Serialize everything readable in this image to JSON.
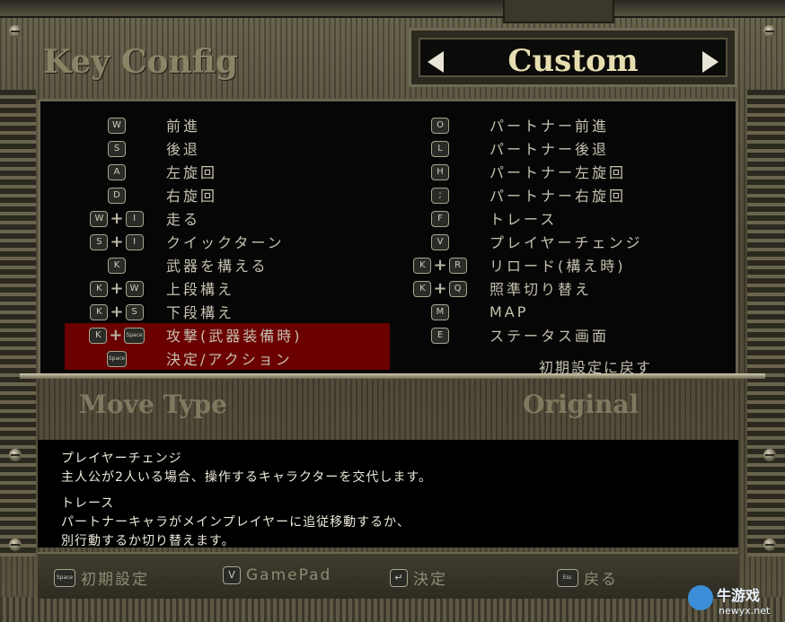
{
  "header": {
    "title": "Key Config",
    "preset": "Custom"
  },
  "bindings_left": [
    {
      "keys": [
        "W"
      ],
      "label": "前進"
    },
    {
      "keys": [
        "S"
      ],
      "label": "後退"
    },
    {
      "keys": [
        "A"
      ],
      "label": "左旋回"
    },
    {
      "keys": [
        "D"
      ],
      "label": "右旋回"
    },
    {
      "keys": [
        "W",
        "+",
        "I"
      ],
      "label": "走る"
    },
    {
      "keys": [
        "S",
        "+",
        "I"
      ],
      "label": "クイックターン"
    },
    {
      "keys": [
        "K"
      ],
      "label": "武器を構える"
    },
    {
      "keys": [
        "K",
        "+",
        "W"
      ],
      "label": "上段構え"
    },
    {
      "keys": [
        "K",
        "+",
        "S"
      ],
      "label": "下段構え"
    },
    {
      "keys": [
        "K",
        "+",
        "Space"
      ],
      "label": "攻撃(武器装備時)"
    },
    {
      "keys": [
        "Space"
      ],
      "label": "決定/アクション"
    }
  ],
  "bindings_right": [
    {
      "keys": [
        "O"
      ],
      "label": "パートナー前進"
    },
    {
      "keys": [
        "L"
      ],
      "label": "パートナー後退"
    },
    {
      "keys": [
        "H"
      ],
      "label": "パートナー左旋回"
    },
    {
      "keys": [
        ";"
      ],
      "label": "パートナー右旋回"
    },
    {
      "keys": [
        "F"
      ],
      "label": "トレース"
    },
    {
      "keys": [
        "V"
      ],
      "label": "プレイヤーチェンジ"
    },
    {
      "keys": [
        "K",
        "+",
        "R"
      ],
      "label": "リロード(構え時)"
    },
    {
      "keys": [
        "K",
        "+",
        "Q"
      ],
      "label": "照準切り替え"
    },
    {
      "keys": [
        "M"
      ],
      "label": "MAP"
    },
    {
      "keys": [
        "E"
      ],
      "label": "ステータス画面"
    }
  ],
  "reset_label": "初期設定に戻す",
  "move_type": {
    "label": "Move Type",
    "value": "Original"
  },
  "description": [
    "プレイヤーチェンジ",
    "主人公が2人いる場合、操作するキャラクターを交代します。",
    "トレース",
    "パートナーキャラがメインプレイヤーに追従移動するか、",
    "別行動するか切り替えます。"
  ],
  "footer": [
    {
      "key": "Space",
      "label": "初期設定"
    },
    {
      "key": "V",
      "label": "GamePad"
    },
    {
      "key": "↵",
      "label": "決定"
    },
    {
      "key": "Esc",
      "label": "戻る"
    }
  ],
  "watermark": {
    "main": "牛游戏",
    "sub": "newyx.net"
  },
  "colors": {
    "highlight": "#6b0000",
    "preset_text": "#e7deb0"
  }
}
